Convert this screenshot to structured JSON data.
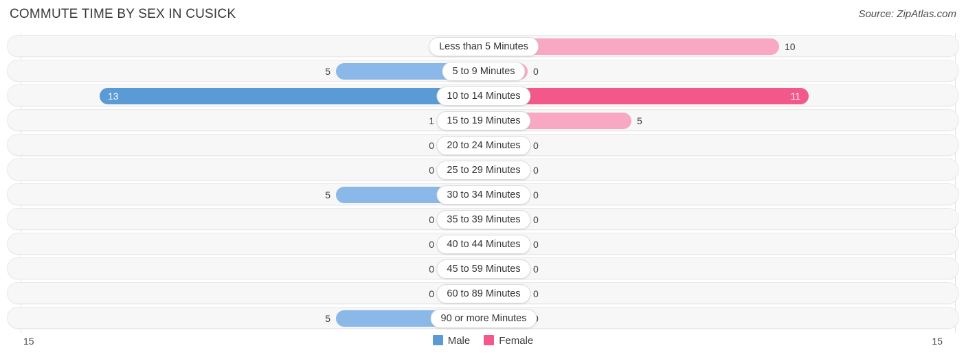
{
  "header": {
    "title": "COMMUTE TIME BY SEX IN CUSICK",
    "source": "Source: ZipAtlas.com"
  },
  "axis": {
    "left_label": "15",
    "right_label": "15"
  },
  "legend": {
    "items": [
      {
        "label": "Male",
        "color": "#5b9bd5"
      },
      {
        "label": "Female",
        "color": "#f2588a"
      }
    ]
  },
  "chart_data": {
    "type": "bar",
    "subtype": "diverging-bidirectional-bar",
    "title": "COMMUTE TIME BY SEX IN CUSICK",
    "xlabel": "",
    "ylabel": "",
    "xlim": [
      15,
      15
    ],
    "axis_max": 15,
    "grid": false,
    "legend_position": "bottom-center",
    "categories": [
      "Less than 5 Minutes",
      "5 to 9 Minutes",
      "10 to 14 Minutes",
      "15 to 19 Minutes",
      "20 to 24 Minutes",
      "25 to 29 Minutes",
      "30 to 34 Minutes",
      "35 to 39 Minutes",
      "40 to 44 Minutes",
      "45 to 59 Minutes",
      "60 to 89 Minutes",
      "90 or more Minutes"
    ],
    "series": [
      {
        "name": "Male",
        "side": "left",
        "color": "#8ab8e8",
        "peak_color": "#5b9bd5",
        "values": [
          0,
          5,
          13,
          1,
          0,
          0,
          5,
          0,
          0,
          0,
          0,
          5
        ],
        "labels": [
          "0",
          "5",
          "13",
          "1",
          "0",
          "0",
          "5",
          "0",
          "0",
          "0",
          "0",
          "5"
        ]
      },
      {
        "name": "Female",
        "side": "right",
        "color": "#f9a8c3",
        "peak_color": "#f2588a",
        "values": [
          10,
          0,
          11,
          5,
          0,
          0,
          0,
          0,
          0,
          0,
          0,
          0
        ],
        "labels": [
          "10",
          "0",
          "11",
          "5",
          "0",
          "0",
          "0",
          "0",
          "0",
          "0",
          "0",
          "0"
        ]
      }
    ]
  }
}
